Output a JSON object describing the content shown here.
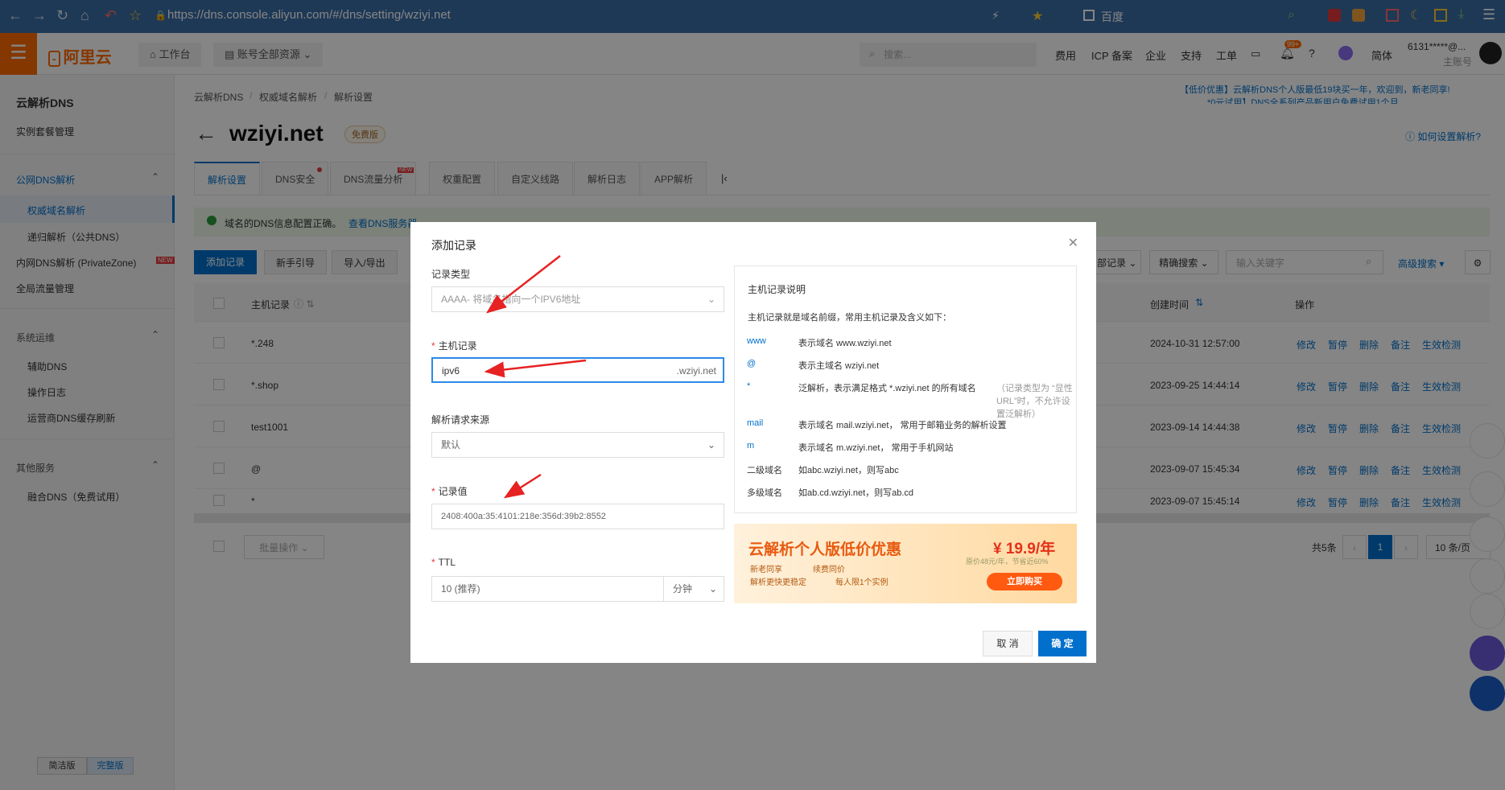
{
  "browser": {
    "url": "https://dns.console.aliyun.com/#/dns/setting/wziyi.net",
    "bookmark": "百度"
  },
  "topbar": {
    "logo": "阿里云",
    "workbench": "工作台",
    "resources": "账号全部资源",
    "search_placeholder": "搜索...",
    "links": [
      "费用",
      "ICP 备案",
      "企业",
      "支持",
      "工单"
    ],
    "badge": "99+",
    "lang": "简体",
    "account": "6131*****@...",
    "account_type": "主账号"
  },
  "sidebar": {
    "title": "云解析DNS",
    "items": [
      {
        "label": "实例套餐管理"
      },
      {
        "label": "公网DNS解析",
        "group": true
      },
      {
        "label": "权威域名解析",
        "active": true
      },
      {
        "label": "递归解析（公共DNS）"
      },
      {
        "label": "内网DNS解析 (PrivateZone)",
        "badge": "NEW"
      },
      {
        "label": "全局流量管理"
      },
      {
        "label": "系统运维",
        "group": true
      },
      {
        "label": "辅助DNS"
      },
      {
        "label": "操作日志"
      },
      {
        "label": "运营商DNS缓存刷新"
      },
      {
        "label": "其他服务",
        "group": true
      },
      {
        "label": "融合DNS（免费试用）"
      }
    ],
    "mode_simple": "简洁版",
    "mode_full": "完整版"
  },
  "main": {
    "breadcrumb": [
      "云解析DNS",
      "权威域名解析",
      "解析设置"
    ],
    "domain": "wziyi.net",
    "edition": "免费版",
    "promo_text_1": "【低价优惠】云解析DNS个人版最低19块买一年，欢迎到，新老同享!",
    "promo_text_2": "*0元试用】DNS全系列产品新用户免费试用1个月",
    "help_link": "如何设置解析?",
    "tabs": [
      "解析设置",
      "DNS安全",
      "DNS流量分析",
      "权重配置",
      "自定义线路",
      "解析日志",
      "APP解析"
    ],
    "tab_new_badge": "NEW",
    "notice": "域名的DNS信息配置正确。",
    "notice_link": "查看DNS服务器",
    "toolbar": {
      "add": "添加记录",
      "guide": "新手引导",
      "import": "导入/导出",
      "all_records": "部记录",
      "exact": "精确搜索",
      "keyword_placeholder": "输入关键字",
      "advanced": "高级搜索"
    },
    "table": {
      "headers": {
        "host": "主机记录",
        "created": "创建时间",
        "ops": "操作"
      },
      "rows": [
        {
          "host": "*.248",
          "created": "2024-10-31 12:57:00"
        },
        {
          "host": "*.shop",
          "created": "2023-09-25 14:44:14"
        },
        {
          "host": "test1001",
          "created": "2023-09-14 14:44:38"
        },
        {
          "host": "@",
          "created": "2023-09-07 15:45:34"
        },
        {
          "host": "*",
          "created": "2023-09-07 15:45:14"
        }
      ],
      "ops": [
        "修改",
        "暂停",
        "删除",
        "备注",
        "生效检测"
      ]
    },
    "batch": "批量操作",
    "pagination": {
      "total": "共5条",
      "page": "1",
      "per_page": "10 条/页"
    }
  },
  "dialog": {
    "title": "添加记录",
    "record_type_label": "记录类型",
    "record_type_value": "AAAA- 将域名指向一个IPV6地址",
    "host_label": "主机记录",
    "host_value": "ipv6",
    "host_suffix": ".wziyi.net",
    "source_label": "解析请求来源",
    "source_value": "默认",
    "value_label": "记录值",
    "value_value": "2408:400a:35:4101:218e:356d:39b2:8552",
    "ttl_label": "TTL",
    "ttl_value": "10 (推荐)",
    "ttl_unit": "分钟",
    "info_title": "主机记录说明",
    "info_desc": "主机记录就是域名前缀，常用主机记录及含义如下：",
    "info_rows": [
      {
        "k": "www",
        "v": "表示域名 www.wziyi.net"
      },
      {
        "k": "@",
        "v": "表示主域名 wziyi.net"
      },
      {
        "k": "*",
        "v": "泛解析，表示满足格式 *.wziyi.net 的所有域名",
        "note": "（记录类型为 “显性URL”时，不允许设置泛解析）"
      },
      {
        "k": "mail",
        "v": "表示域名 mail.wziyi.net， 常用于邮箱业务的解析设置"
      },
      {
        "k": "m",
        "v": "表示域名 m.wziyi.net， 常用于手机网站"
      },
      {
        "k": "二级域名",
        "v": "如abc.wziyi.net，则写abc"
      },
      {
        "k": "多级域名",
        "v": "如ab.cd.wziyi.net，则写ab.cd"
      }
    ],
    "promo": {
      "title": "云解析个人版低价优惠",
      "price": "¥ 19.9/年",
      "orig": "原价48元/年，节省近60%",
      "tag1": "新老同享",
      "tag2": "续费同价",
      "tag3": "解析更快更稳定",
      "tag4": "每人限1个实例",
      "cta": "立即购买"
    },
    "cancel": "取 消",
    "ok": "确 定"
  }
}
